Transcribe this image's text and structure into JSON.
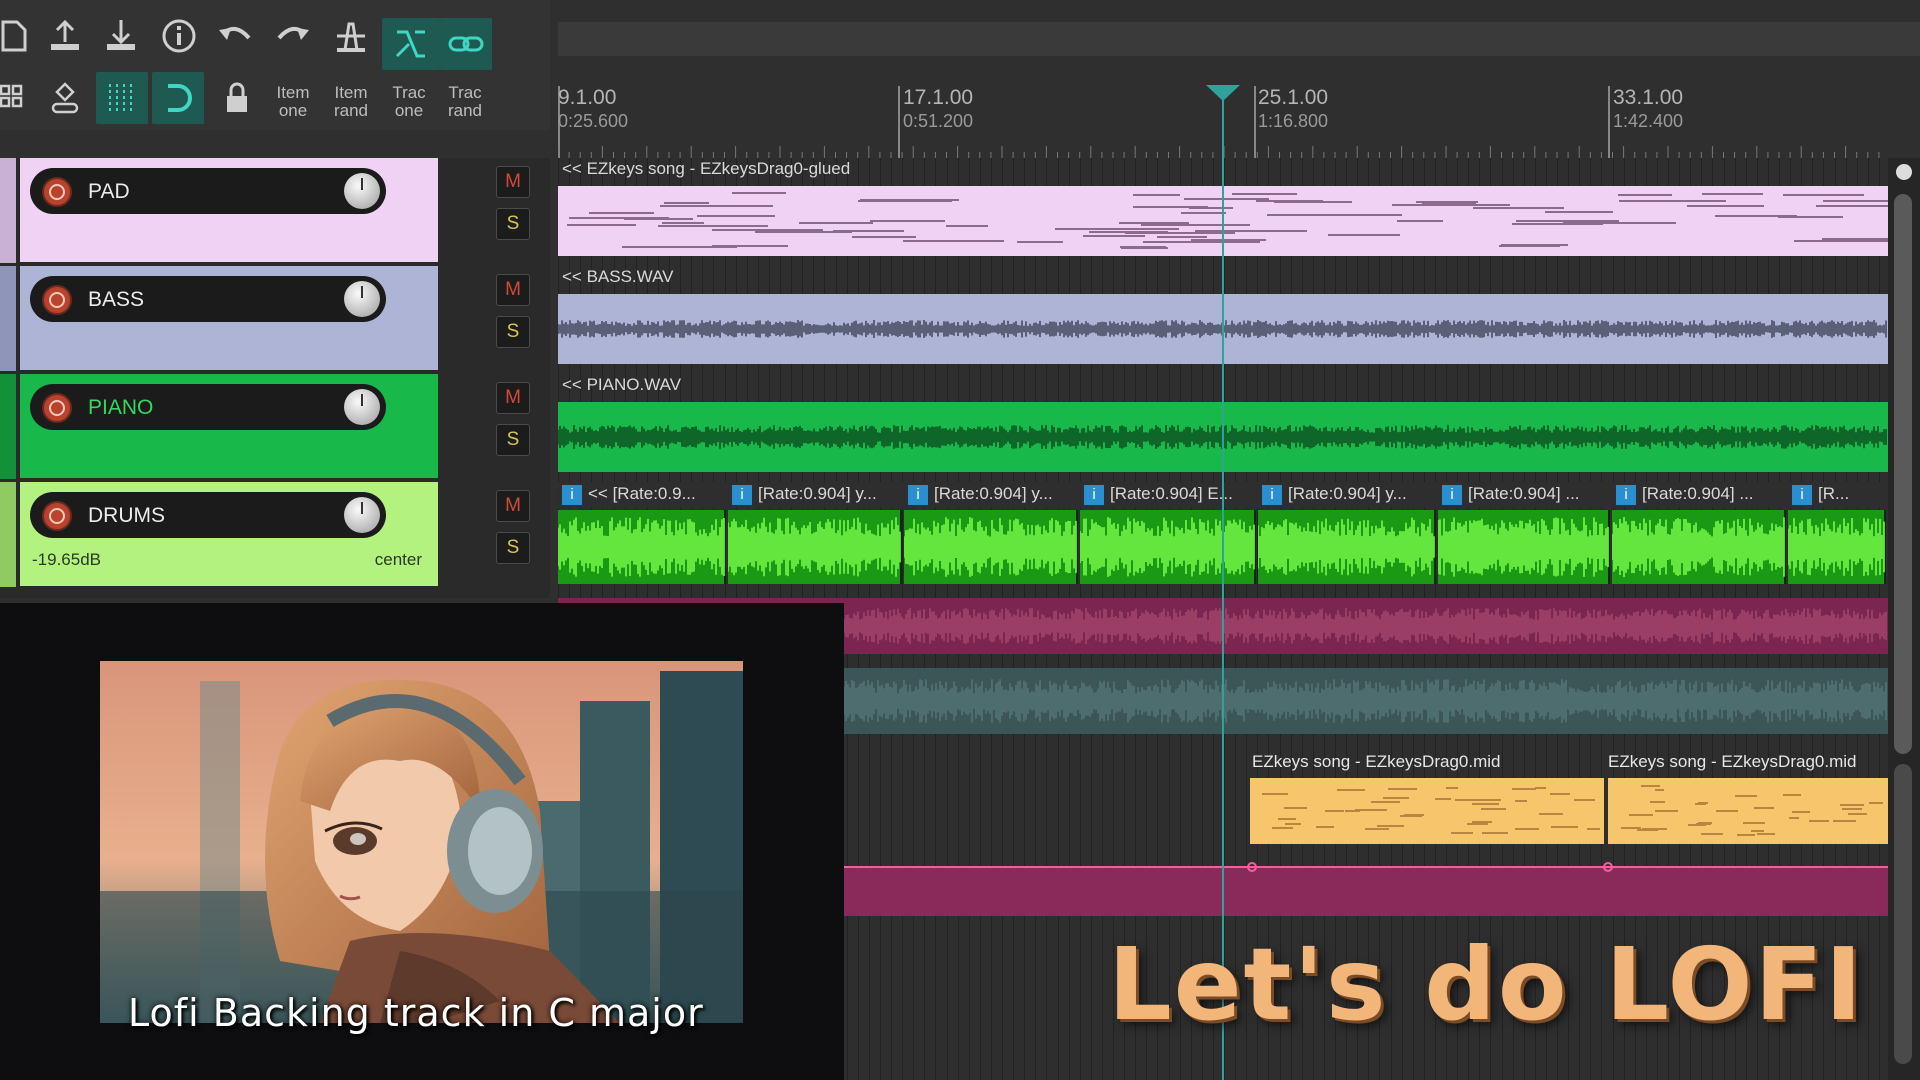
{
  "toolbar": {
    "row1": [
      {
        "name": "new-project-icon"
      },
      {
        "name": "upload-icon"
      },
      {
        "name": "download-icon"
      },
      {
        "name": "info-icon"
      },
      {
        "name": "undo-icon"
      },
      {
        "name": "redo-icon"
      },
      {
        "name": "metronome-icon"
      },
      {
        "name": "ripple-edit-icon",
        "active": true
      },
      {
        "name": "link-icon",
        "active": true
      }
    ],
    "row2": [
      {
        "name": "grid-view-icon"
      },
      {
        "name": "route-icon"
      },
      {
        "name": "snap-grid-icon",
        "active": true
      },
      {
        "name": "loop-snap-icon",
        "active": true
      },
      {
        "name": "lock-icon"
      },
      {
        "name": "item-one",
        "label1": "Item",
        "label2": "one"
      },
      {
        "name": "item-rand",
        "label1": "Item",
        "label2": "rand"
      },
      {
        "name": "trac-one",
        "label1": "Trac",
        "label2": "one"
      },
      {
        "name": "trac-rand",
        "label1": "Trac",
        "label2": "rand"
      }
    ]
  },
  "ruler": {
    "markers": [
      {
        "bar": "9.1.00",
        "time": "0:25.600"
      },
      {
        "bar": "17.1.00",
        "time": "0:51.200"
      },
      {
        "bar": "25.1.00",
        "time": "1:16.800"
      },
      {
        "bar": "33.1.00",
        "time": "1:42.400"
      }
    ]
  },
  "tracks": [
    {
      "name": "PAD",
      "color": "#f0d2f5",
      "strip": "#c9b1d4",
      "name_color": "#ececec"
    },
    {
      "name": "BASS",
      "color": "#aeb4d6",
      "strip": "#8f95b8",
      "name_color": "#ececec"
    },
    {
      "name": "PIANO",
      "color": "#18b94a",
      "strip": "#12903a",
      "name_color": "#34d860"
    },
    {
      "name": "DRUMS",
      "color": "#b3f27f",
      "strip": "#8fcb60",
      "name_color": "#ececec",
      "volume": "-19.65dB",
      "pan": "center"
    }
  ],
  "mute_label": "M",
  "solo_label": "S",
  "items": {
    "pad": "<< EZkeys song - EZkeysDrag0-glued",
    "bass": "<< BASS.WAV",
    "piano": "<< PIANO.WAV",
    "drums": [
      "<< [Rate:0.9...",
      "[Rate:0.904] y...",
      "[Rate:0.904] y...",
      "[Rate:0.904] E...",
      "[Rate:0.904] y...",
      "[Rate:0.904] ...",
      "[Rate:0.904] ...",
      "[R..."
    ],
    "midi": [
      "EZkeys song - EZkeysDrag0.mid",
      "EZkeys song - EZkeysDrag0.mid"
    ]
  },
  "overlay": {
    "caption": "Lofi  Backing  track  in  C  major",
    "headline": "Let's  do  LOFI"
  },
  "colors": {
    "accent": "#2fa39a",
    "pad": "#f0d2f5",
    "bass": "#aeb4d6",
    "piano": "#18b94a",
    "drums": "#1fa81a",
    "magenta": "#8a2a5a",
    "teal": "#3f5e60",
    "midi": "#f6c56c",
    "headline": "#f3b67a"
  }
}
